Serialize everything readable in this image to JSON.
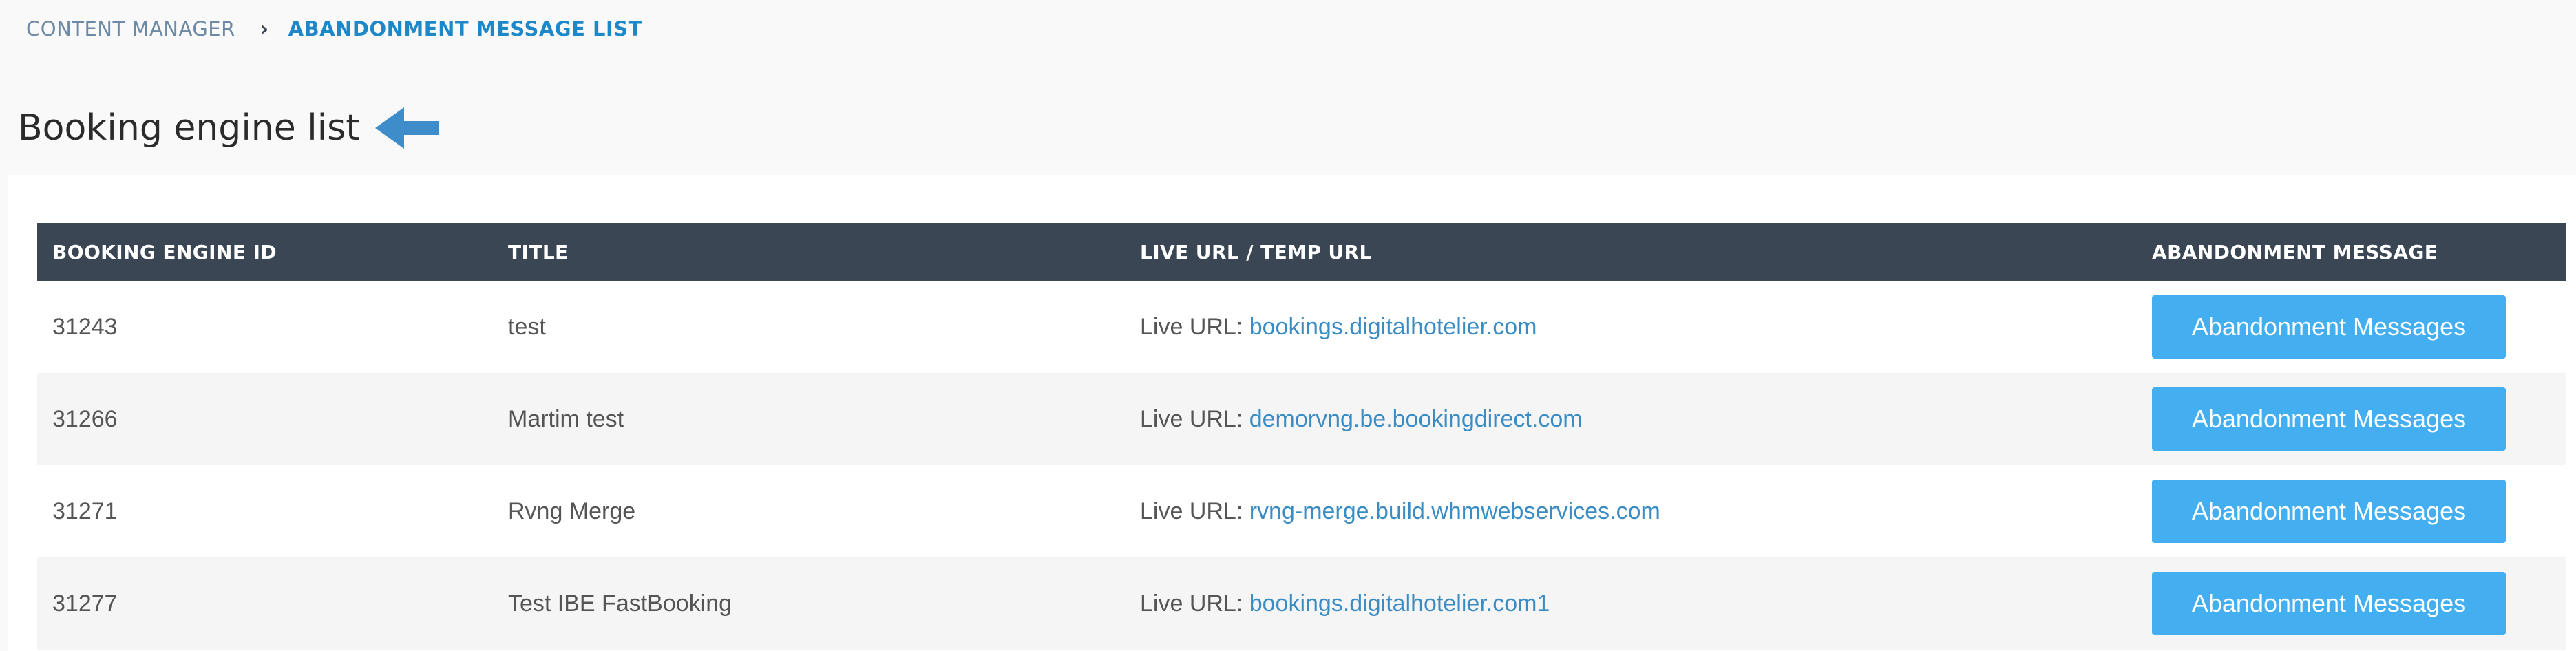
{
  "breadcrumb": {
    "parent": "CONTENT MANAGER",
    "separator": "›",
    "current": "ABANDONMENT MESSAGE LIST"
  },
  "page": {
    "title": "Booking engine list",
    "back_icon": "arrow-left-icon"
  },
  "colors": {
    "header_bg": "#3a4654",
    "accent": "#1c87c9",
    "button_bg": "#43aef0",
    "link": "#3a8cc4"
  },
  "table": {
    "columns": [
      "BOOKING ENGINE ID",
      "TITLE",
      "LIVE URL / TEMP URL",
      "ABANDONMENT MESSAGE"
    ],
    "rows": [
      {
        "id": "31243",
        "title": "test",
        "url_prefix": "Live URL:",
        "url": "bookings.digitalhotelier.com",
        "button": "Abandonment Messages"
      },
      {
        "id": "31266",
        "title": "Martim test",
        "url_prefix": "Live URL:",
        "url": "demorvng.be.bookingdirect.com",
        "button": "Abandonment Messages"
      },
      {
        "id": "31271",
        "title": "Rvng Merge",
        "url_prefix": "Live URL:",
        "url": "rvng-merge.build.whmwebservices.com",
        "button": "Abandonment Messages"
      },
      {
        "id": "31277",
        "title": "Test IBE FastBooking",
        "url_prefix": "Live URL:",
        "url": "bookings.digitalhotelier.com1",
        "button": "Abandonment Messages"
      }
    ]
  }
}
